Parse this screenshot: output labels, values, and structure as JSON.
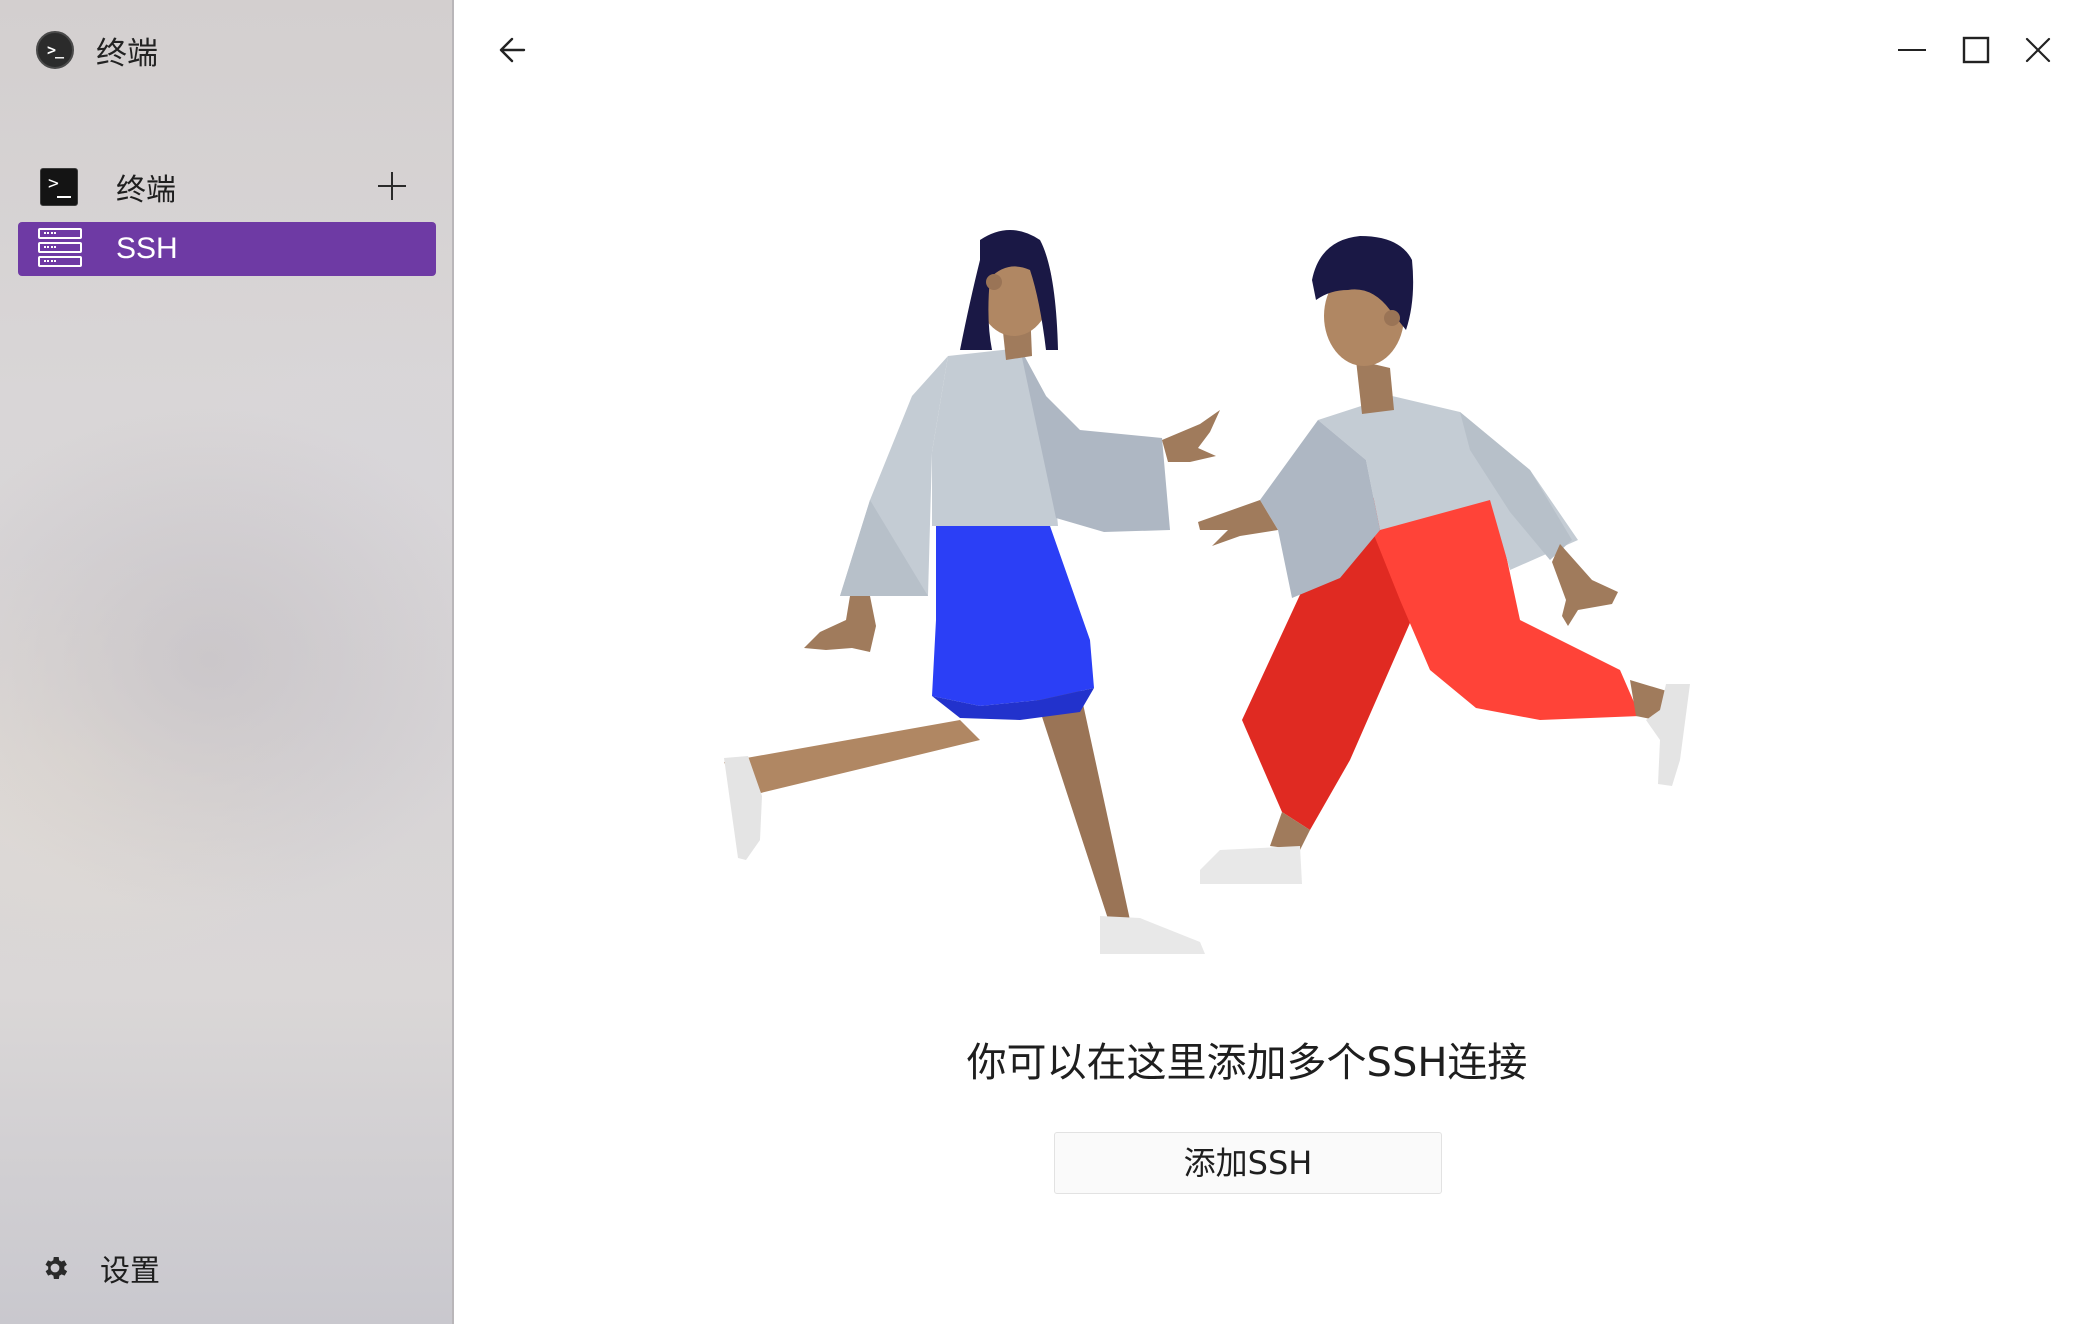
{
  "app": {
    "title": "终端",
    "logo_glyph": ">_",
    "logo_icon": "terminal-circle-icon"
  },
  "sidebar": {
    "items": [
      {
        "label": "终端",
        "icon": "terminal-icon",
        "active": false,
        "has_add": true
      },
      {
        "label": "SSH",
        "icon": "server-icon",
        "active": true
      }
    ],
    "add_icon": "plus-icon",
    "settings": {
      "label": "设置",
      "icon": "gear-icon"
    },
    "active_color": "#6e3aa4"
  },
  "window_controls": {
    "back_icon": "arrow-left-icon",
    "minimize_icon": "minimize-icon",
    "maximize_icon": "maximize-icon",
    "close_icon": "close-icon"
  },
  "main": {
    "empty_state_text": "你可以在这里添加多个SSH连接",
    "add_button_label": "添加SSH",
    "illustration": "two-people-reaching-illustration",
    "colors": {
      "skirt": "#2b3ff6",
      "pants": "#e02a22",
      "shirt": "#c4ccd4",
      "hair": "#1a1845",
      "skin": "#b08763"
    }
  }
}
